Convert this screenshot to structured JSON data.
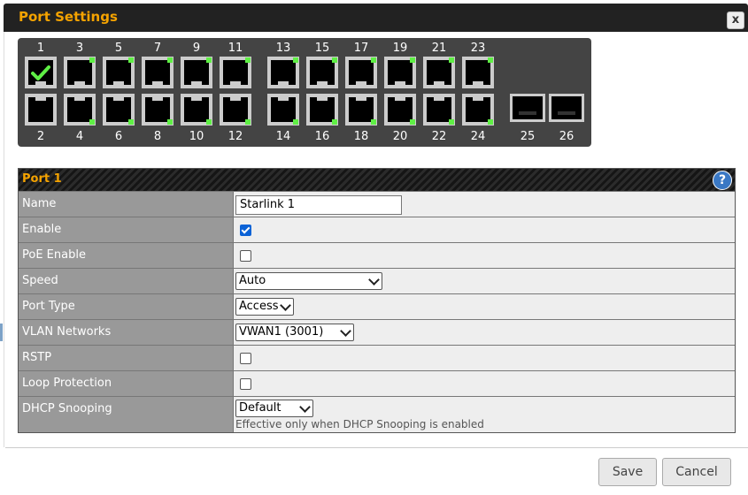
{
  "dialog": {
    "title": "Port Settings",
    "close_label": "x"
  },
  "switch": {
    "top_ports": [
      {
        "num": "1",
        "selected": true,
        "link": false
      },
      {
        "num": "3",
        "selected": false,
        "link": true
      },
      {
        "num": "5",
        "selected": false,
        "link": true
      },
      {
        "num": "7",
        "selected": false,
        "link": true
      },
      {
        "num": "9",
        "selected": false,
        "link": true
      },
      {
        "num": "11",
        "selected": false,
        "link": true
      },
      {
        "num": "13",
        "selected": false,
        "link": true
      },
      {
        "num": "15",
        "selected": false,
        "link": true
      },
      {
        "num": "17",
        "selected": false,
        "link": true
      },
      {
        "num": "19",
        "selected": false,
        "link": true
      },
      {
        "num": "21",
        "selected": false,
        "link": true
      },
      {
        "num": "23",
        "selected": false,
        "link": true
      }
    ],
    "bottom_ports": [
      {
        "num": "2",
        "link": false
      },
      {
        "num": "4",
        "link": true
      },
      {
        "num": "6",
        "link": true
      },
      {
        "num": "8",
        "link": true
      },
      {
        "num": "10",
        "link": true
      },
      {
        "num": "12",
        "link": true
      },
      {
        "num": "14",
        "link": true
      },
      {
        "num": "16",
        "link": true
      },
      {
        "num": "18",
        "link": true
      },
      {
        "num": "20",
        "link": true
      },
      {
        "num": "22",
        "link": true
      },
      {
        "num": "24",
        "link": true
      }
    ],
    "sfp_ports": [
      "25",
      "26"
    ]
  },
  "panel": {
    "title": "Port 1",
    "help_label": "?",
    "fields": {
      "name": {
        "label": "Name",
        "value": "Starlink 1"
      },
      "enable": {
        "label": "Enable",
        "checked": true
      },
      "poe": {
        "label": "PoE Enable",
        "checked": false
      },
      "speed": {
        "label": "Speed",
        "value": "Auto"
      },
      "port_type": {
        "label": "Port Type",
        "value": "Access"
      },
      "vlan": {
        "label": "VLAN Networks",
        "value": "VWAN1 (3001)"
      },
      "rstp": {
        "label": "RSTP",
        "checked": false
      },
      "loop": {
        "label": "Loop Protection",
        "checked": false
      },
      "dhcp": {
        "label": "DHCP Snooping",
        "value": "Default",
        "hint": "Effective only when DHCP Snooping is enabled"
      }
    }
  },
  "footer": {
    "save_label": "Save",
    "cancel_label": "Cancel"
  },
  "colors": {
    "accent": "#f5a300",
    "link_led": "#5fef45",
    "checkbox": "#0b62d6"
  }
}
